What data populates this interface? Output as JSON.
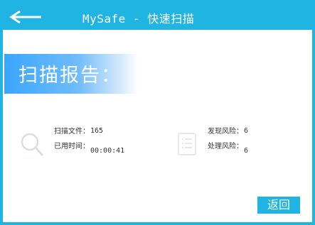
{
  "window": {
    "title": "MySafe - 快速扫描",
    "back_icon": "back-arrow-icon",
    "accent_color": "#1fb4e1"
  },
  "banner": {
    "title": "扫描报告："
  },
  "stats": {
    "scanned_files_label": "扫描文件：",
    "scanned_files_value": "165",
    "elapsed_time_label": "已用时间：",
    "elapsed_time_value": "00:00:41",
    "risks_found_label": "发现风险：",
    "risks_found_value": "6",
    "risks_handled_label": "处理风险：",
    "risks_handled_value": "6",
    "left_icon": "search-icon",
    "right_icon": "document-icon"
  },
  "footer": {
    "back_label": "返回"
  }
}
